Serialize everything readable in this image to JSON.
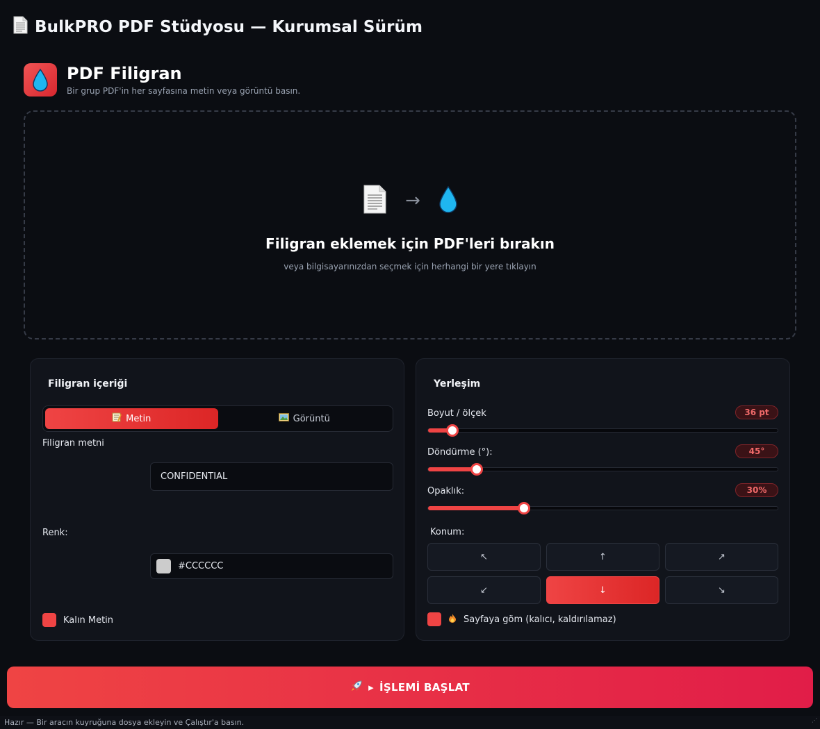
{
  "window": {
    "title": "BulkPRO PDF Stüdyosu — Kurumsal Sürüm"
  },
  "tool": {
    "title": "PDF Filigran",
    "subtitle": "Bir grup PDF'in her sayfasına metin veya görüntü basın."
  },
  "dropzone": {
    "arrow": "→",
    "title": "Filigran eklemek için PDF'leri bırakın",
    "subtitle": "veya bilgisayarınızdan seçmek için herhangi bir yere tıklayın"
  },
  "content_panel": {
    "title": "Filigran içeriği",
    "tabs": [
      {
        "icon": "memo-icon",
        "label": "Metin",
        "active": true
      },
      {
        "icon": "picture-icon",
        "label": "Görüntü",
        "active": false
      }
    ],
    "text_label": "Filigran metni",
    "text_value": "CONFIDENTIAL",
    "color_label": "Renk:",
    "color_value": "#CCCCCC",
    "bold_label": "Kalın Metin",
    "bold_checked": true
  },
  "layout_panel": {
    "title": "Yerleşim",
    "size": {
      "label": "Boyut / ölçek",
      "value": "36 pt",
      "fraction": 0.07
    },
    "rotation": {
      "label": "Döndürme (°):",
      "value": "45°",
      "fraction": 0.14
    },
    "opacity": {
      "label": "Opaklık:",
      "value": "30%",
      "fraction": 0.275
    },
    "position_label": "Konum:",
    "positions": [
      {
        "glyph": "↖",
        "active": false
      },
      {
        "glyph": "↑",
        "active": false
      },
      {
        "glyph": "↗",
        "active": false
      },
      {
        "glyph": "↙",
        "active": false
      },
      {
        "glyph": "↓",
        "active": true
      },
      {
        "glyph": "↘",
        "active": false
      }
    ],
    "flatten_label": "Sayfaya göm (kalıcı, kaldırılamaz)",
    "flatten_checked": true
  },
  "run_button": {
    "label": "İŞLEMİ BAŞLAT",
    "play": "▸"
  },
  "status": {
    "text": "Hazır — Bir aracın kuyruğuna dosya ekleyin ve Çalıştır'a basın."
  },
  "colors": {
    "accent": "#ef4444",
    "background": "#0b0d12",
    "panel": "#11141b"
  }
}
